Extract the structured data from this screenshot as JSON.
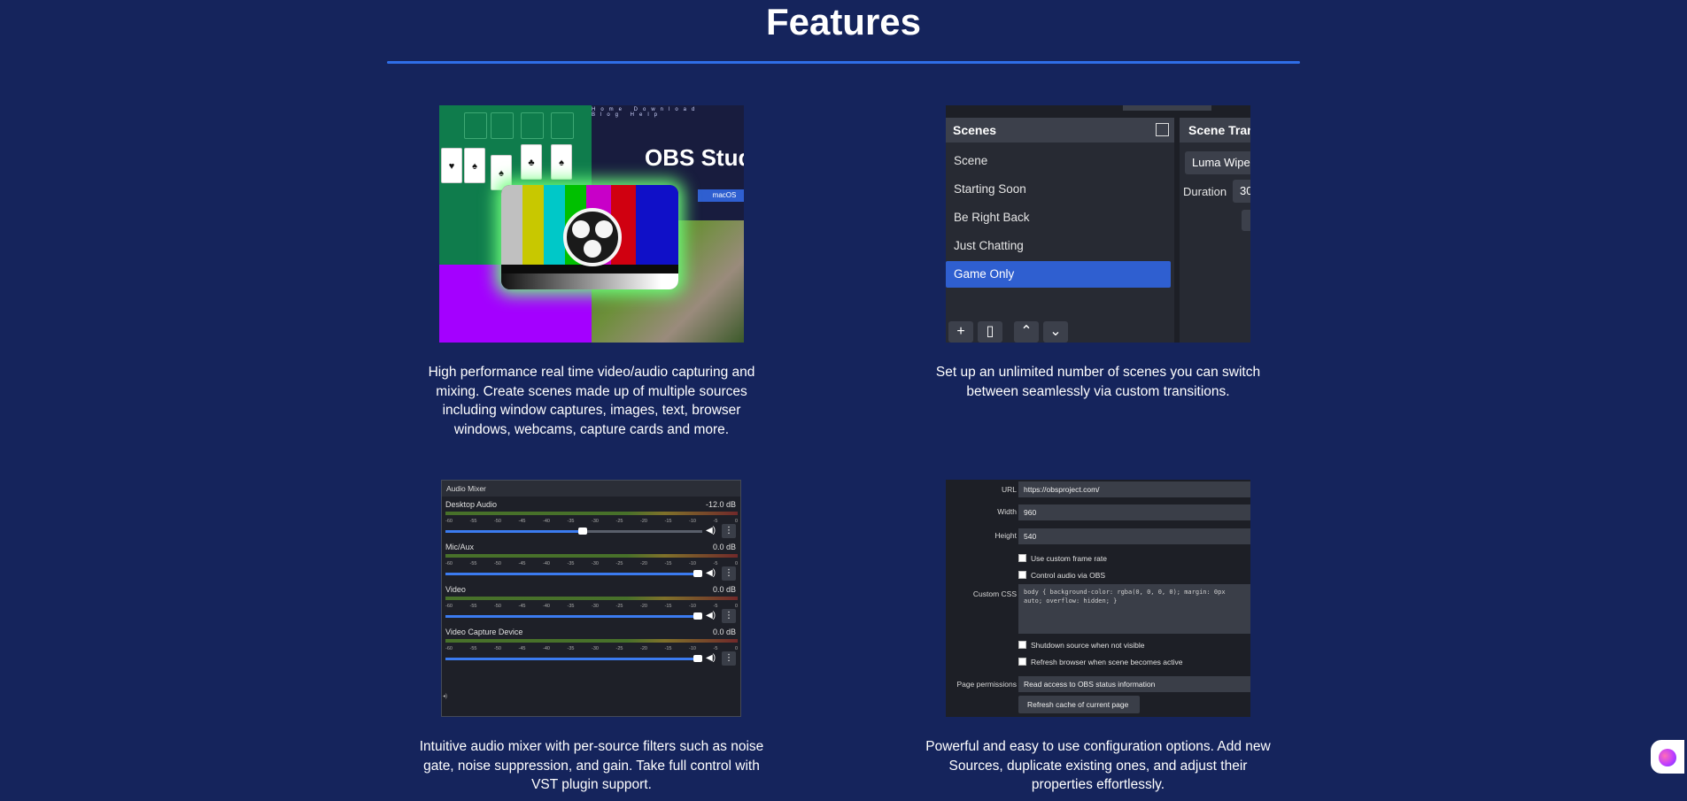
{
  "page": {
    "title": "Features"
  },
  "features": [
    {
      "description": "High performance real time video/audio capturing and mixing. Create scenes made up of multiple sources including window captures, images, text, browser windows, webcams, capture cards and more.",
      "image": {
        "site_nav": "Home Download Blog Help",
        "site_title": "OBS Stud",
        "macos_button": "macOS"
      }
    },
    {
      "description": "Set up an unlimited number of scenes you can switch between seamlessly via custom transitions.",
      "image": {
        "scenes_header": "Scenes",
        "scenes": [
          "Scene",
          "Starting Soon",
          "Be Right Back",
          "Just Chatting",
          "Game Only"
        ],
        "selected_scene": "Game Only",
        "transitions_header": "Scene Tran",
        "transition_value": "Luma Wipe",
        "duration_label": "Duration",
        "duration_value": "30"
      }
    },
    {
      "description": "Intuitive audio mixer with per-source filters such as noise gate, noise suppression, and gain. Take full control with VST plugin support.",
      "image": {
        "mixer_title": "Audio Mixer",
        "ticks": [
          "-60",
          "-55",
          "-50",
          "-45",
          "-40",
          "-35",
          "-30",
          "-25",
          "-20",
          "-15",
          "-10",
          "-5",
          "0"
        ],
        "channels": [
          {
            "name": "Desktop Audio",
            "db": "-12.0 dB",
            "level": 0.55
          },
          {
            "name": "Mic/Aux",
            "db": "0.0 dB",
            "level": 1.0
          },
          {
            "name": "Video",
            "db": "0.0 dB",
            "level": 1.0
          },
          {
            "name": "Video Capture Device",
            "db": "0.0 dB",
            "level": 1.0
          }
        ]
      }
    },
    {
      "description": "Powerful and easy to use configuration options. Add new Sources, duplicate existing ones, and adjust their properties effortlessly.",
      "image": {
        "url_label": "URL",
        "url_value": "https://obsproject.com/",
        "width_label": "Width",
        "width_value": "960",
        "height_label": "Height",
        "height_value": "540",
        "custom_frame_rate": "Use custom frame rate",
        "control_audio": "Control audio via OBS",
        "custom_css_label": "Custom CSS",
        "custom_css_value": "body { background-color: rgba(0, 0, 0, 0); margin: 0px auto; overflow: hidden; }",
        "shutdown": "Shutdown source when not visible",
        "refresh_active": "Refresh browser when scene becomes active",
        "permissions_label": "Page permissions",
        "permissions_value": "Read access to OBS status information",
        "refresh_cache": "Refresh cache of current page"
      }
    }
  ],
  "colors": {
    "background": "#15245c",
    "accent": "#2f6ee8",
    "selected": "#2f5fd0"
  },
  "widget": {
    "icon": "brain-icon"
  }
}
